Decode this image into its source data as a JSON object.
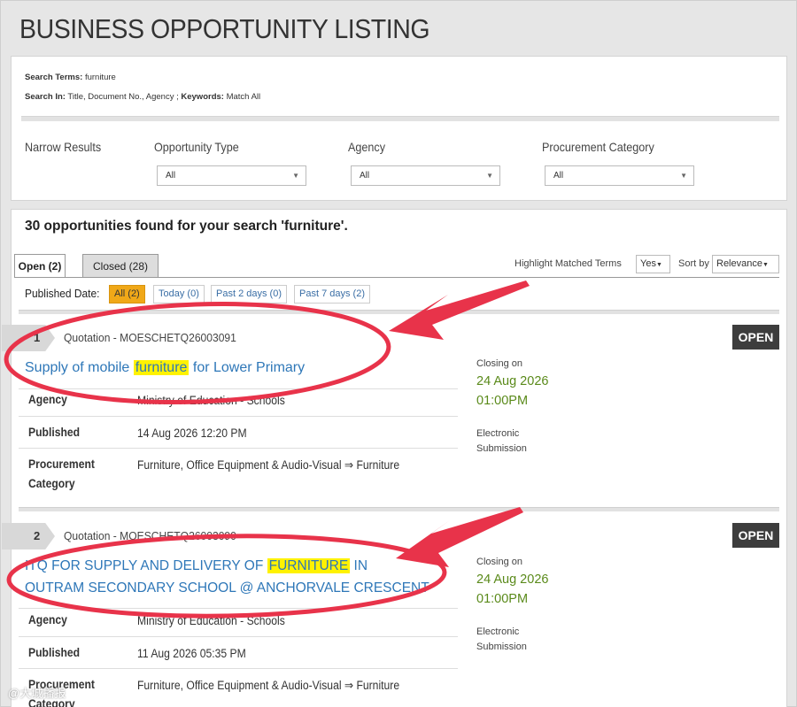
{
  "page": {
    "title": "BUSINESS OPPORTUNITY LISTING"
  },
  "search": {
    "terms_label": "Search Terms:",
    "terms_value": "furniture",
    "in_label": "Search In:",
    "in_value": "Title, Document No., Agency ;",
    "keywords_label": "Keywords:",
    "keywords_value": "Match All"
  },
  "filters": {
    "narrow_label": "Narrow Results",
    "opportunity_type": {
      "label": "Opportunity Type",
      "value": "All"
    },
    "agency": {
      "label": "Agency",
      "value": "All"
    },
    "procurement_category": {
      "label": "Procurement Category",
      "value": "All"
    }
  },
  "results": {
    "found_text": "30 opportunities found for your search 'furniture'.",
    "tabs": [
      {
        "label": "Open (2)"
      },
      {
        "label": "Closed (28)"
      }
    ],
    "highlight_label": "Highlight Matched Terms",
    "highlight_value": "Yes",
    "sort_label": "Sort by",
    "sort_value": "Relevance",
    "published_label": "Published Date:",
    "date_filters": [
      {
        "label": "All (2)"
      },
      {
        "label": "Today (0)"
      },
      {
        "label": "Past 2 days (0)"
      },
      {
        "label": "Past 7 days (2)"
      }
    ]
  },
  "items": [
    {
      "number": "1",
      "doc_id": "Quotation - MOESCHETQ26003091",
      "status": "OPEN",
      "title_pre": "Supply of mobile ",
      "title_hl": "furniture",
      "title_post": " for Lower Primary",
      "agency_label": "Agency",
      "agency_value": "Ministry of Education - Schools",
      "published_label": "Published",
      "published_value": "14 Aug 2026 12:20 PM",
      "category_label_1": "Procurement",
      "category_label_2": "Category",
      "category_value": "Furniture, Office Equipment & Audio-Visual ⇒ Furniture",
      "closing_label": "Closing on",
      "closing_date": "24 Aug 2026",
      "closing_time": "01:00PM",
      "submission_1": "Electronic",
      "submission_2": "Submission"
    },
    {
      "number": "2",
      "doc_id": "Quotation - MOESCHETQ26003090",
      "status": "OPEN",
      "title_pre": "ITQ FOR SUPPLY AND DELIVERY OF ",
      "title_hl": "FURNITURE",
      "title_post": " IN",
      "title_line2": "OUTRAM SECONDARY SCHOOL @ ANCHORVALE CRESCENT",
      "agency_label": "Agency",
      "agency_value": "Ministry of Education - Schools",
      "published_label": "Published",
      "published_value": "11 Aug 2026 05:35 PM",
      "category_label_1": "Procurement",
      "category_label_2": "Category",
      "category_value": "Furniture, Office Equipment & Audio-Visual ⇒ Furniture",
      "closing_label": "Closing on",
      "closing_date": "24 Aug 2026",
      "closing_time": "01:00PM",
      "submission_1": "Electronic",
      "submission_2": "Submission"
    }
  ],
  "watermark": "@大城播报",
  "colors": {
    "accent_red": "#e8334a",
    "link_blue": "#2e77b8",
    "date_green": "#5a8a1a",
    "highlight": "#fff200"
  }
}
